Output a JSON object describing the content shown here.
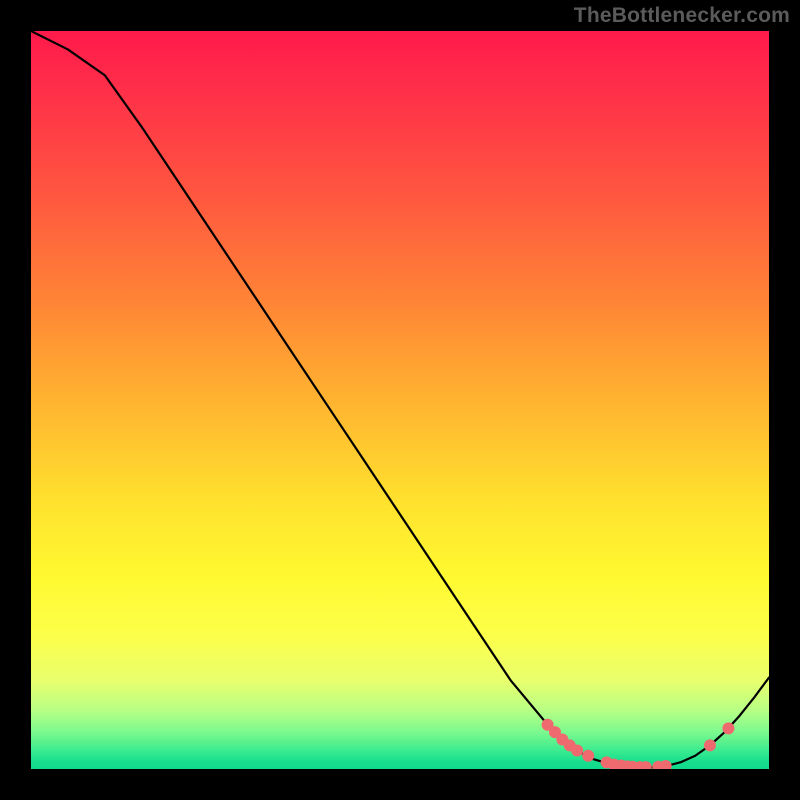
{
  "attribution": "TheBottlenecker.com",
  "colors": {
    "page_bg": "#000000",
    "attribution_text": "#5b5b5b",
    "curve_stroke": "#000000",
    "marker_fill": "#ef6a6f",
    "marker_stroke": "#ef6a6f"
  },
  "chart_data": {
    "type": "line",
    "title": "",
    "xlabel": "",
    "ylabel": "",
    "xlim": [
      0,
      100
    ],
    "ylim": [
      0,
      100
    ],
    "grid": false,
    "note": "Axes unlabeled; values are estimated from pixel positions on a 0–100 plot-area scale. y increases upward (0 = bottom of gradient, 100 = top).",
    "series": [
      {
        "name": "bottleneck-curve",
        "x": [
          0,
          5,
          10,
          15,
          20,
          25,
          30,
          35,
          40,
          45,
          50,
          55,
          60,
          65,
          70,
          72,
          74,
          76,
          78,
          80,
          82,
          84,
          86,
          88,
          90,
          92,
          94,
          96,
          98,
          100
        ],
        "y": [
          100,
          97.5,
          94,
          87,
          79.5,
          72,
          64.5,
          57,
          49.5,
          42,
          34.5,
          27,
          19.5,
          12,
          6,
          4,
          2.5,
          1.4,
          0.8,
          0.4,
          0.2,
          0.2,
          0.4,
          0.9,
          1.8,
          3.2,
          5.0,
          7.2,
          9.7,
          12.4
        ]
      }
    ],
    "markers": {
      "name": "highlight-dots",
      "points_xy": [
        [
          70.0,
          6.0
        ],
        [
          71.0,
          5.0
        ],
        [
          72.0,
          4.0
        ],
        [
          73.0,
          3.2
        ],
        [
          74.0,
          2.5
        ],
        [
          75.5,
          1.8
        ],
        [
          78.0,
          0.9
        ],
        [
          79.0,
          0.6
        ],
        [
          80.0,
          0.45
        ],
        [
          80.8,
          0.35
        ],
        [
          81.5,
          0.3
        ],
        [
          82.5,
          0.25
        ],
        [
          83.3,
          0.25
        ],
        [
          85.0,
          0.3
        ],
        [
          86.0,
          0.4
        ],
        [
          92.0,
          3.2
        ],
        [
          94.5,
          5.5
        ]
      ]
    }
  }
}
